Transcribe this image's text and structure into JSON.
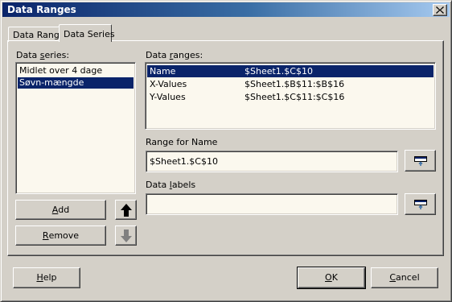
{
  "window": {
    "title": "Data Ranges"
  },
  "tabs": [
    {
      "label": "Data Range"
    },
    {
      "label": "Data Series"
    }
  ],
  "series_panel": {
    "label_prefix": "Data ",
    "label_accel": "s",
    "label_suffix": "eries:",
    "items": [
      {
        "label": "Midlet over 4 dage",
        "selected": false
      },
      {
        "label": "Søvn-mængde",
        "selected": true
      }
    ]
  },
  "ranges_panel": {
    "label_prefix": "Data ",
    "label_accel": "r",
    "label_suffix": "anges:",
    "rows": [
      {
        "role": "Name",
        "range": "$Sheet1.$C$10",
        "selected": true
      },
      {
        "role": "X-Values",
        "range": "$Sheet1.$B$11:$B$16",
        "selected": false
      },
      {
        "role": "Y-Values",
        "range": "$Sheet1.$C$11:$C$16",
        "selected": false
      }
    ]
  },
  "range_for": {
    "label": "Range for Name",
    "value": "$Sheet1.$C$10"
  },
  "data_labels": {
    "label_prefix": "Data ",
    "label_accel": "l",
    "label_suffix": "abels",
    "value": ""
  },
  "buttons": {
    "add_accel": "A",
    "add_rest": "dd",
    "remove_accel": "R",
    "remove_rest": "emove",
    "help_accel": "H",
    "help_rest": "elp",
    "ok_accel": "O",
    "ok_rest": "K",
    "cancel_accel": "C",
    "cancel_rest": "ancel"
  },
  "icons": {
    "close": "close-icon",
    "up": "arrow-up-icon",
    "down": "arrow-down-icon",
    "picker": "shrink-dialog-icon"
  },
  "colors": {
    "dialog_bg": "#d4d0c8",
    "field_bg": "#fbf8ee",
    "selection": "#0a246a",
    "title_start": "#0a246a",
    "title_end": "#a6caf0"
  }
}
